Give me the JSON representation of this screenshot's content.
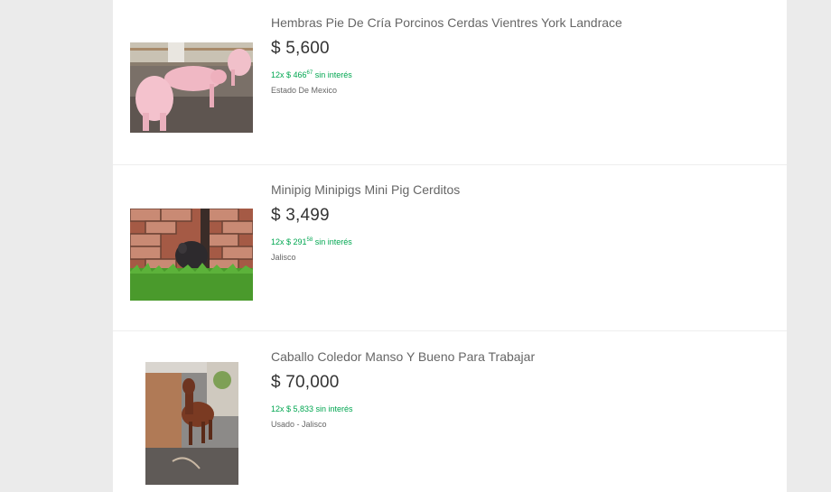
{
  "listings": [
    {
      "title": "Hembras Pie De Cría Porcinos Cerdas Vientres York Landrace",
      "price": "$ 5,600",
      "installments": {
        "prefix": "12x $ 466",
        "cents": "67",
        "suffix": " sin interés"
      },
      "location": "Estado De Mexico",
      "image_icon": "pigs-photo"
    },
    {
      "title": "Minipig Minipigs Mini Pig Cerditos",
      "price": "$ 3,499",
      "installments": {
        "prefix": "12x $ 291",
        "cents": "58",
        "suffix": " sin interés"
      },
      "location": "Jalisco",
      "image_icon": "minipig-photo"
    },
    {
      "title": "Caballo Coledor Manso Y Bueno Para Trabajar",
      "price": "$ 70,000",
      "installments": {
        "prefix": "12x $ 5,833 sin interés",
        "cents": "",
        "suffix": ""
      },
      "location": "Usado - Jalisco",
      "image_icon": "horse-photo"
    }
  ],
  "colors": {
    "background": "#ebebeb",
    "card": "#ffffff",
    "installments_green": "#00a650",
    "title_gray": "#666666",
    "price_dark": "#333333"
  }
}
